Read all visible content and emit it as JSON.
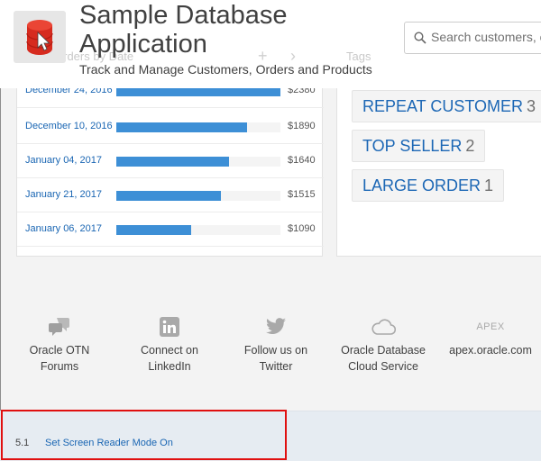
{
  "header": {
    "title": "Sample Database Application",
    "subtitle": "Track and Manage Customers, Orders and Products",
    "search_placeholder": "Search customers, o",
    "ghost_labels": [
      "Orders by Date",
      "Tags"
    ]
  },
  "chart_data": {
    "type": "bar",
    "categories": [
      "December 24, 2016",
      "December 10, 2016",
      "January 04, 2017",
      "January 21, 2017",
      "January 06, 2017"
    ],
    "values": [
      2380,
      1890,
      1640,
      1515,
      1090
    ],
    "value_labels": [
      "$2380",
      "$1890",
      "$1640",
      "$1515",
      "$1090"
    ],
    "xlim": [
      0,
      2380
    ],
    "bar_color": "#3d8fd6"
  },
  "tags": [
    {
      "label": "REPEAT CUSTOMER",
      "count": "3"
    },
    {
      "label": "TOP SELLER",
      "count": "2"
    },
    {
      "label": "LARGE ORDER",
      "count": "1"
    }
  ],
  "links": [
    {
      "icon": "forums-icon",
      "label": "Oracle OTN Forums"
    },
    {
      "icon": "linkedin-icon",
      "label": "Connect on LinkedIn"
    },
    {
      "icon": "twitter-icon",
      "label": "Follow us on Twitter"
    },
    {
      "icon": "cloud-icon",
      "label": "Oracle Database Cloud Service"
    },
    {
      "icon": "apex-icon",
      "icon_text": "APEX",
      "label": "apex.oracle.com"
    }
  ],
  "footer": {
    "version": "5.1",
    "screen_reader_link": "Set Screen Reader Mode On"
  },
  "colors": {
    "link": "#1a66b3",
    "highlight": "#e01010",
    "logo": "#d62b1f"
  }
}
